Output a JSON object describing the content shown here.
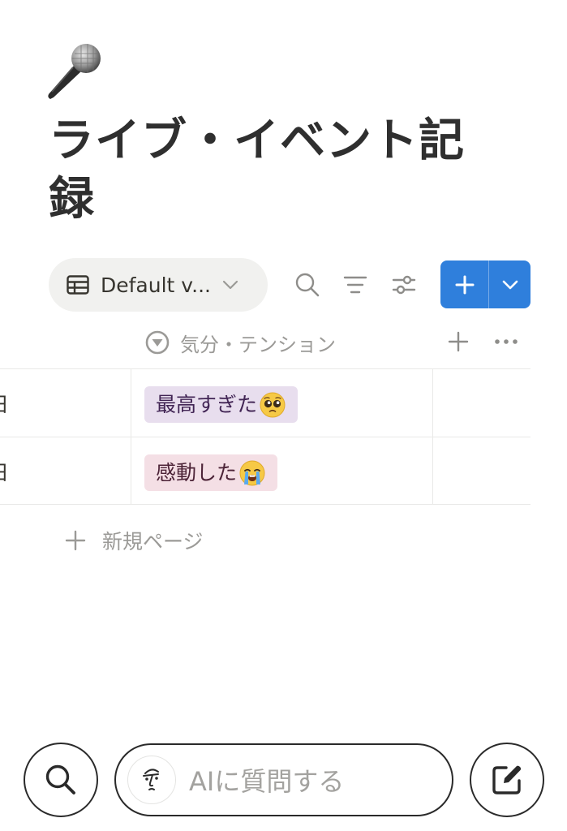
{
  "page": {
    "icon": "microphone-icon",
    "title": "ライブ・イベント記録"
  },
  "toolbar": {
    "view_label": "Default v...",
    "view_icon": "table-icon",
    "search_icon": "search-icon",
    "sort_icon": "sort-icon",
    "settings_icon": "sliders-icon",
    "new_button_icon": "plus-icon",
    "new_dropdown_icon": "chevron-down-icon",
    "accent_color": "#2f7fdc"
  },
  "table": {
    "property_header": {
      "icon": "select-property-icon",
      "label": "気分・テンション"
    },
    "rows": [
      {
        "date_fragment": "日",
        "tag_text": "最高すぎた",
        "tag_emoji": "pleading-face-icon",
        "tag_color": "#e8deee",
        "tag_text_color": "#412454"
      },
      {
        "date_fragment": "日",
        "tag_text": "感動した",
        "tag_emoji": "crying-face-icon",
        "tag_color": "#f4dfe5",
        "tag_text_color": "#4c2337"
      }
    ],
    "new_page_label": "新規ページ"
  },
  "bottom_bar": {
    "search_icon": "search-icon",
    "ai_placeholder": "AIに質問する",
    "ai_icon": "notion-ai-face-icon",
    "compose_icon": "compose-icon"
  }
}
